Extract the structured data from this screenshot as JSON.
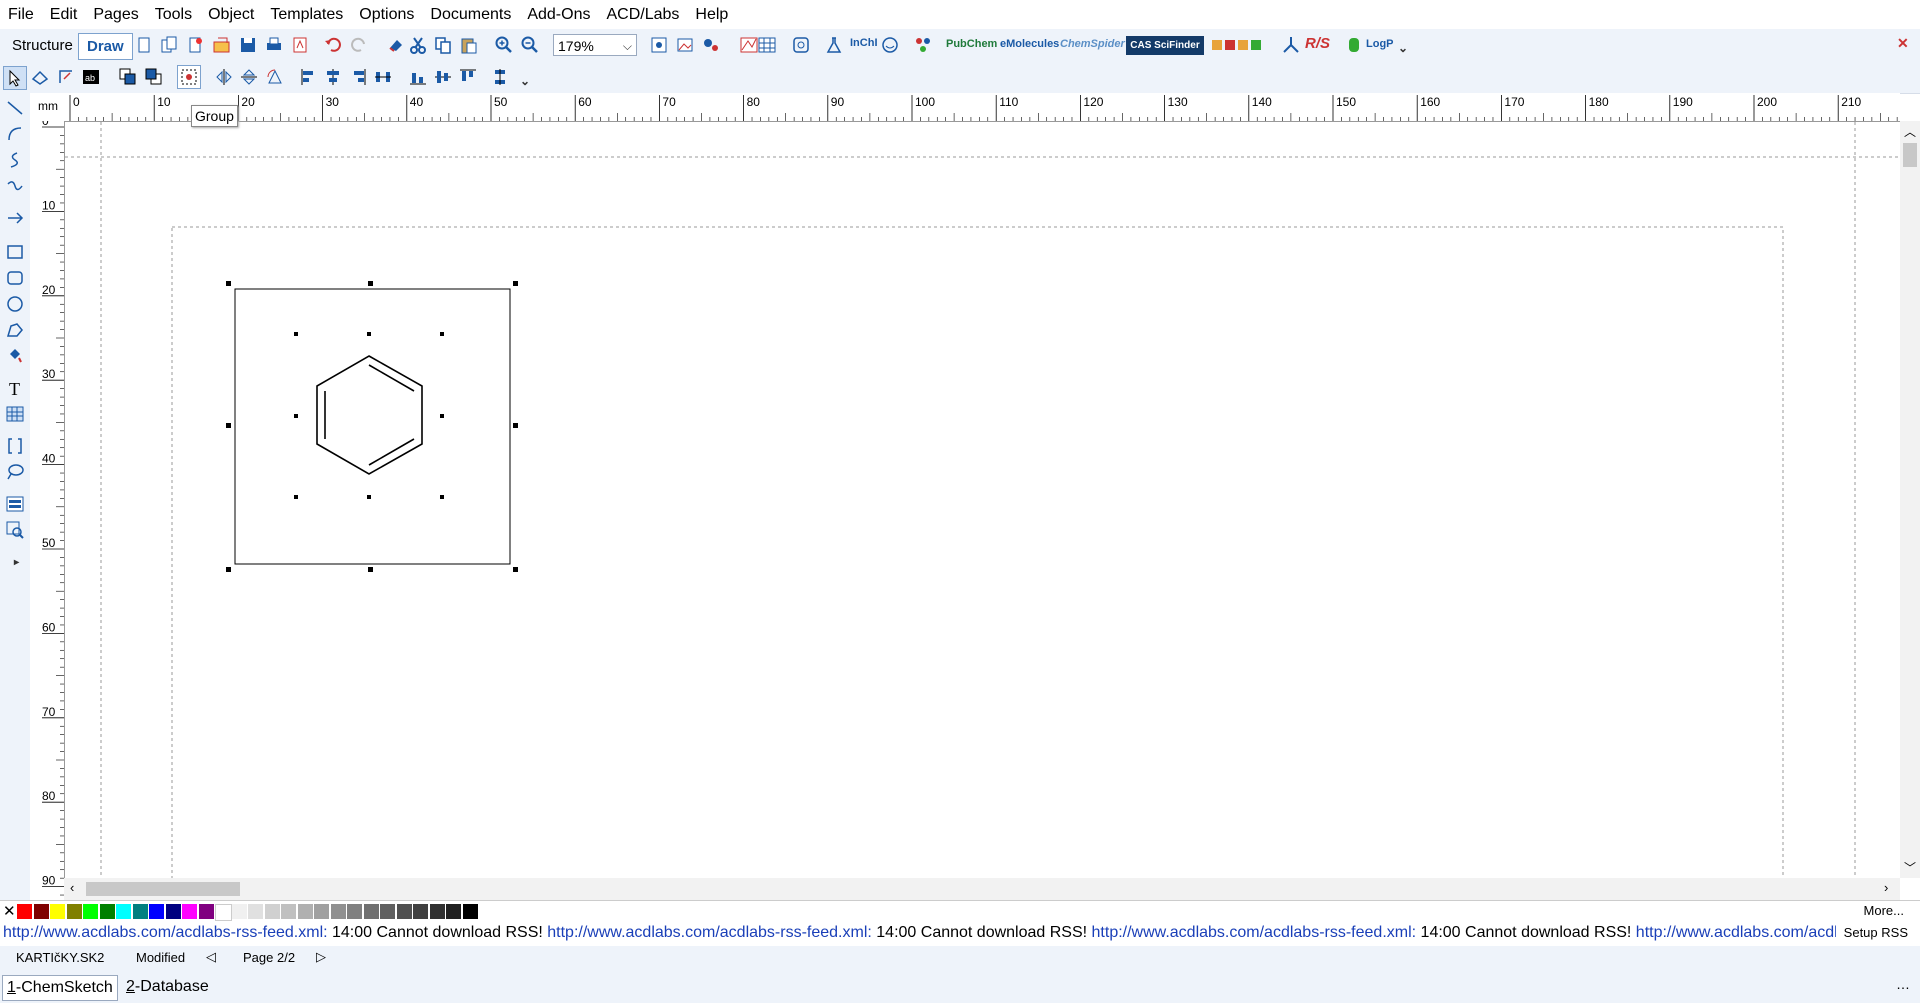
{
  "menu": [
    "File",
    "Edit",
    "Pages",
    "Tools",
    "Object",
    "Templates",
    "Options",
    "Documents",
    "Add-Ons",
    "ACD/Labs",
    "Help"
  ],
  "toolbar": {
    "mode_structure": "Structure",
    "mode_draw": "Draw",
    "zoom_value": "179%",
    "pubchem": "PubChem",
    "emolecules": "eMolecules",
    "chemspider": "ChemSpider",
    "cas": "CAS SciFinder",
    "rs": "R/S",
    "logp": "LogP",
    "inchi": "InChI"
  },
  "tooltip": "Group",
  "ruler": {
    "unit": "mm",
    "h_ticks": [
      "0",
      "10",
      "20",
      "30",
      "40",
      "50",
      "60",
      "70",
      "80",
      "90",
      "100",
      "110",
      "120",
      "130",
      "140",
      "150",
      "160",
      "170",
      "180",
      "190",
      "200",
      "210"
    ],
    "v_ticks": [
      "0",
      "10",
      "20",
      "30",
      "40",
      "50",
      "60",
      "70",
      "80",
      "90"
    ]
  },
  "palette": {
    "colors": [
      "#ff0000",
      "#800000",
      "#ffff00",
      "#808000",
      "#00ff00",
      "#008000",
      "#00ffff",
      "#008080",
      "#0000ff",
      "#000080",
      "#ff00ff",
      "#800080",
      "#ffffff",
      "#f0f0f0",
      "#e0e0e0",
      "#d0d0d0",
      "#c0c0c0",
      "#b0b0b0",
      "#a0a0a0",
      "#909090",
      "#808080",
      "#707070",
      "#606060",
      "#505050",
      "#404040",
      "#303030",
      "#202020",
      "#000000"
    ],
    "more_label": "More..."
  },
  "rss": {
    "link": "http://www.acdlabs.com/acdlabs-rss-feed.xml:",
    "message": " 14:00 Cannot download RSS! ",
    "link_partial": "http://www.acdlabs.com/acdlabs-r",
    "setup_label": "Setup RSS"
  },
  "status": {
    "filename": "KARTIčKY.SK2",
    "modified": "Modified",
    "page": "Page 2/2"
  },
  "tasks": {
    "t1_num": "1",
    "t1_label": "-ChemSketch",
    "t2_num": "2",
    "t2_label": "-Database"
  },
  "window": {
    "close_glyph": "✕"
  },
  "colors": {
    "accent": "#1b5aa6",
    "toolbar_bg": "#eef3fa",
    "link": "#1a3fb8"
  }
}
